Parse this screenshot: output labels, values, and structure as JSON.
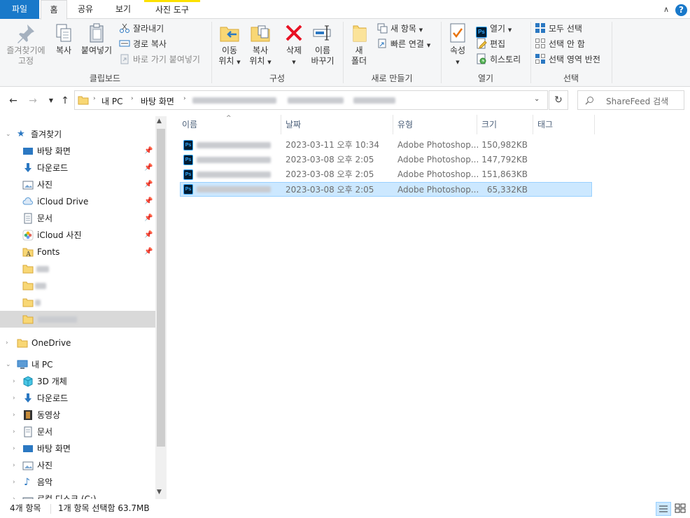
{
  "tabs": {
    "file": "파일",
    "home": "홈",
    "share": "공유",
    "view": "보기",
    "picture_tools": "사진 도구"
  },
  "ribbon": {
    "clipboard": {
      "pin_line1": "즐겨찾기에",
      "pin_line2": "고정",
      "copy": "복사",
      "paste": "붙여넣기",
      "cut": "잘라내기",
      "copy_path": "경로 복사",
      "paste_shortcut": "바로 가기 붙여넣기",
      "label": "클립보드"
    },
    "organize": {
      "move_line1": "이동",
      "move_line2": "위치",
      "copy_line1": "복사",
      "copy_line2": "위치",
      "delete": "삭제",
      "rename_line1": "이름",
      "rename_line2": "바꾸기",
      "label": "구성"
    },
    "new": {
      "new_folder_line1": "새",
      "new_folder_line2": "폴더",
      "new_item": "새 항목",
      "easy_access": "빠른 연결",
      "label": "새로 만들기"
    },
    "open": {
      "properties": "속성",
      "open": "열기",
      "edit": "편집",
      "history": "히스토리",
      "label": "열기"
    },
    "select": {
      "select_all": "모두 선택",
      "select_none": "선택 안 함",
      "invert": "선택 영역 반전",
      "label": "선택"
    }
  },
  "address": {
    "crumb1": "내 PC",
    "crumb2": "바탕 화면",
    "search_placeholder": "ShareFeed 검색"
  },
  "nav": {
    "quick_access": "즐겨찾기",
    "quick_items": [
      "바탕 화면",
      "다운로드",
      "사진",
      "iCloud Drive",
      "문서",
      "iCloud 사진",
      "Fonts"
    ],
    "onedrive": "OneDrive",
    "this_pc": "내 PC",
    "pc_items": [
      "3D 개체",
      "다운로드",
      "동영상",
      "문서",
      "바탕 화면",
      "사진",
      "음악",
      "로컬 디스크 (C:)"
    ]
  },
  "columns": {
    "name": "이름",
    "date": "날짜",
    "type": "유형",
    "size": "크기",
    "tags": "태그"
  },
  "files": [
    {
      "date": "2023-03-11 오후 10:34",
      "type": "Adobe Photoshop...",
      "size": "150,982KB"
    },
    {
      "date": "2023-03-08 오후 2:05",
      "type": "Adobe Photoshop...",
      "size": "147,792KB"
    },
    {
      "date": "2023-03-08 오후 2:05",
      "type": "Adobe Photoshop...",
      "size": "151,863KB"
    },
    {
      "date": "2023-03-08 오후 2:05",
      "type": "Adobe Photoshop...",
      "size": "65,332KB"
    }
  ],
  "status": {
    "count": "4개 항목",
    "selected": "1개 항목 선택함 63.7MB"
  },
  "colors": {
    "file_tab": "#1979ca",
    "selection": "#cce8ff",
    "selection_border": "#99d1ff",
    "context_tab_accent": "#fce100"
  }
}
